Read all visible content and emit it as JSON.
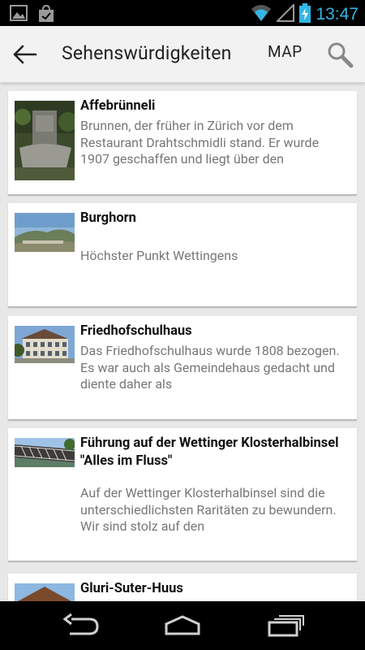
{
  "status_bar": {
    "time": "13:47",
    "icons": [
      "gallery-notification-icon",
      "shopping-bag-notification-icon",
      "wifi-icon",
      "signal-icon",
      "battery-charging-icon"
    ],
    "accent_color": "#33b5e5"
  },
  "action_bar": {
    "title": "Sehenswürdigkeiten",
    "map_label": "MAP",
    "back_icon": "arrow-back-icon",
    "search_icon": "search-icon"
  },
  "items": [
    {
      "title": "Affebrünneli",
      "description": "Brunnen, der früher in Zürich vor dem Restaurant Drahtschmidli stand. Er wurde 1907 geschaffen und liegt über den",
      "thumbnail": "fountain-photo"
    },
    {
      "title": "Burghorn",
      "description": "Höchster Punkt Wettingens",
      "thumbnail": "landscape-photo"
    },
    {
      "title": "Friedhofschulhaus",
      "description": "Das Friedhofschulhaus wurde 1808 bezogen. Es war auch als Gemeindehaus gedacht und diente daher als",
      "thumbnail": "building-photo"
    },
    {
      "title": "Führung auf der Wettinger Klosterhalbinsel \"Alles im Fluss\"",
      "description": "Auf der Wettinger Klosterhalbinsel sind die unterschiedlichsten Raritäten zu bewundern. Wir sind stolz auf den",
      "thumbnail": "bridge-photo"
    },
    {
      "title": "Gluri-Suter-Huus",
      "description": "",
      "thumbnail": "house-photo"
    }
  ],
  "nav_bar": {
    "back": "nav-back-icon",
    "home": "nav-home-icon",
    "recents": "nav-recents-icon"
  }
}
